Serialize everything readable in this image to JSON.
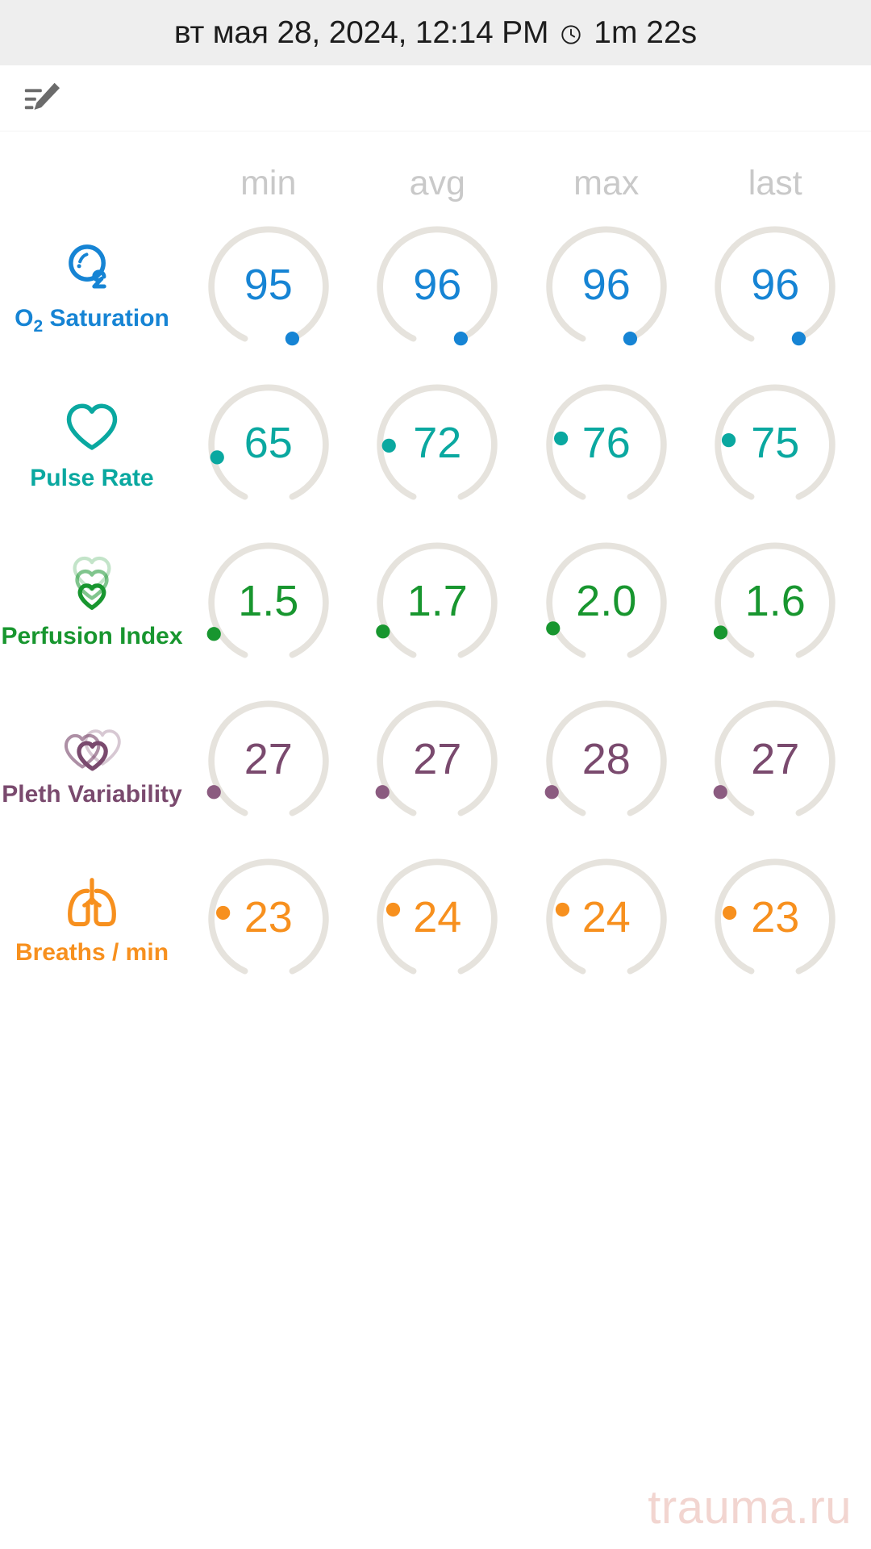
{
  "header": {
    "date_text": "вт мая 28, 2024, 12:14 PM",
    "clock_icon": "clock-icon",
    "duration": "1m 22s",
    "background": "#eeeeee"
  },
  "actions": {
    "note_edit_icon": "note-edit-icon"
  },
  "columns": [
    {
      "key": "min",
      "label": "min"
    },
    {
      "key": "avg",
      "label": "avg"
    },
    {
      "key": "max",
      "label": "max"
    },
    {
      "key": "last",
      "label": "last"
    }
  ],
  "column_header_color": "#c9c9c9",
  "gauge_track_color": "#e6e3dd",
  "metrics": [
    {
      "id": "spo2",
      "icon": "o2-bubble-icon",
      "name_prefix": "O",
      "name_sub": "2",
      "name_suffix": " Saturation",
      "name_full": "O2 Saturation",
      "color": "#1684d4",
      "unit_max": 100,
      "values": [
        {
          "column": "min",
          "value": "95",
          "fraction": 0.95
        },
        {
          "column": "avg",
          "value": "96",
          "fraction": 0.96
        },
        {
          "column": "max",
          "value": "96",
          "fraction": 0.96
        },
        {
          "column": "last",
          "value": "96",
          "fraction": 0.96
        }
      ]
    },
    {
      "id": "pulse-rate",
      "icon": "heart-outline-icon",
      "name_full": "Pulse Rate",
      "color": "#0aa8a0",
      "unit_max": 220,
      "values": [
        {
          "column": "min",
          "value": "65",
          "fraction": 0.04
        },
        {
          "column": "avg",
          "value": "72",
          "fraction": 0.07
        },
        {
          "column": "max",
          "value": "76",
          "fraction": 0.09
        },
        {
          "column": "last",
          "value": "75",
          "fraction": 0.085
        }
      ]
    },
    {
      "id": "perfusion-index",
      "icon": "triple-heart-icon",
      "name_full": "Perfusion Index",
      "color": "#18962f",
      "unit_max": 20,
      "values": [
        {
          "column": "min",
          "value": "1.5",
          "fraction": 0.005
        },
        {
          "column": "avg",
          "value": "1.7",
          "fraction": 0.012
        },
        {
          "column": "max",
          "value": "2.0",
          "fraction": 0.02
        },
        {
          "column": "last",
          "value": "1.6",
          "fraction": 0.01
        }
      ]
    },
    {
      "id": "pleth-variability",
      "icon": "overlapping-hearts-icon",
      "name_full": "Pleth Variability",
      "color": "#7a4a6e",
      "unit_max": 100,
      "values": [
        {
          "column": "min",
          "value": "27",
          "fraction": 0.0
        },
        {
          "column": "avg",
          "value": "27",
          "fraction": 0.0
        },
        {
          "column": "max",
          "value": "28",
          "fraction": 0.0
        },
        {
          "column": "last",
          "value": "27",
          "fraction": 0.0
        }
      ]
    },
    {
      "id": "breaths-per-min",
      "icon": "lungs-icon",
      "name_full": "Breaths / min",
      "color": "#f7901e",
      "unit_max": 60,
      "values": [
        {
          "column": "min",
          "value": "23",
          "fraction": 0.0
        },
        {
          "column": "avg",
          "value": "24",
          "fraction": 0.0
        },
        {
          "column": "max",
          "value": "24",
          "fraction": 0.0
        },
        {
          "column": "last",
          "value": "23",
          "fraction": 0.0
        }
      ]
    }
  ],
  "watermark": {
    "text": "trauma.ru",
    "color": "#f2d5d0"
  }
}
